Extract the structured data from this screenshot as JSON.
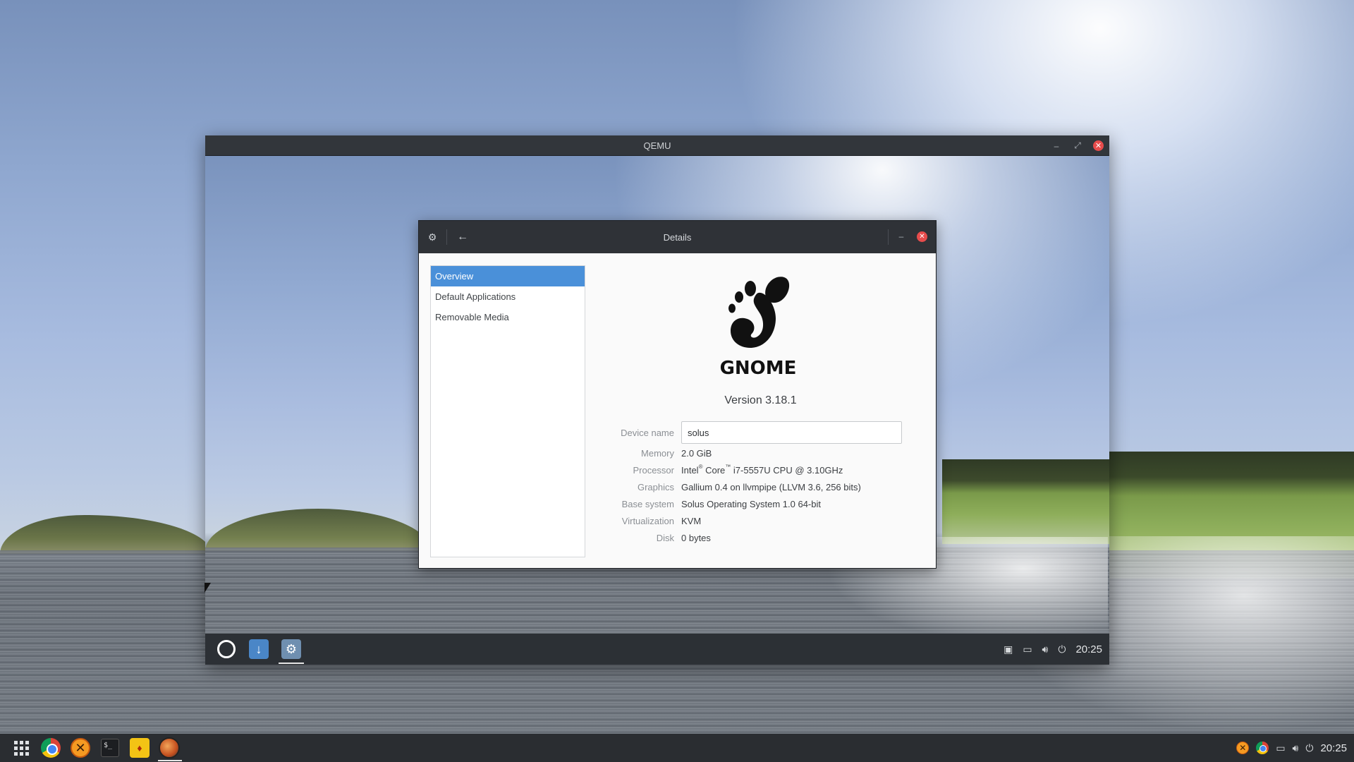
{
  "qemu": {
    "title": "QEMU",
    "controls": {
      "minimize": "–",
      "restore": "⤢",
      "close": "✕"
    }
  },
  "details": {
    "title": "Details",
    "back_icon": "arrow-left-icon",
    "settings_icon": "gear-icon",
    "controls": {
      "minimize": "–",
      "close": "✕"
    },
    "sidebar": [
      {
        "label": "Overview",
        "active": true
      },
      {
        "label": "Default Applications",
        "active": false
      },
      {
        "label": "Removable Media",
        "active": false
      }
    ],
    "logo_text": "GNOME",
    "version": "Version 3.18.1",
    "info": {
      "device_name_label": "Device name",
      "device_name_value": "solus",
      "memory_label": "Memory",
      "memory_value": "2.0 GiB",
      "processor_label": "Processor",
      "processor_value_a": "Intel",
      "processor_sup_a": "®",
      "processor_value_b": " Core",
      "processor_sup_b": "™",
      "processor_value_c": " i7-5557U CPU @ 3.10GHz",
      "graphics_label": "Graphics",
      "graphics_value": "Gallium 0.4 on llvmpipe (LLVM 3.6, 256 bits)",
      "base_system_label": "Base system",
      "base_system_value": "Solus Operating System 1.0 64-bit",
      "virtualization_label": "Virtualization",
      "virtualization_value": "KVM",
      "disk_label": "Disk",
      "disk_value": "0 bytes"
    }
  },
  "vm_panel": {
    "apps": [
      "menu-icon",
      "download-icon",
      "settings-icon"
    ],
    "active_app": "settings-icon",
    "clock": "20:25",
    "tray": [
      "workspace-icon",
      "notification-icon",
      "volume-icon",
      "power-icon"
    ]
  },
  "host_panel": {
    "apps": [
      "app-grid-icon",
      "chrome-icon",
      "hexchat-icon",
      "terminal-icon",
      "yellow-app-icon",
      "qemu-icon"
    ],
    "active_app": "qemu-icon",
    "clock": "20:25",
    "tray": [
      "hexchat-tray-icon",
      "chrome-tray-icon",
      "notification-icon",
      "volume-icon",
      "power-icon"
    ],
    "terminal_glyph": "$_"
  }
}
